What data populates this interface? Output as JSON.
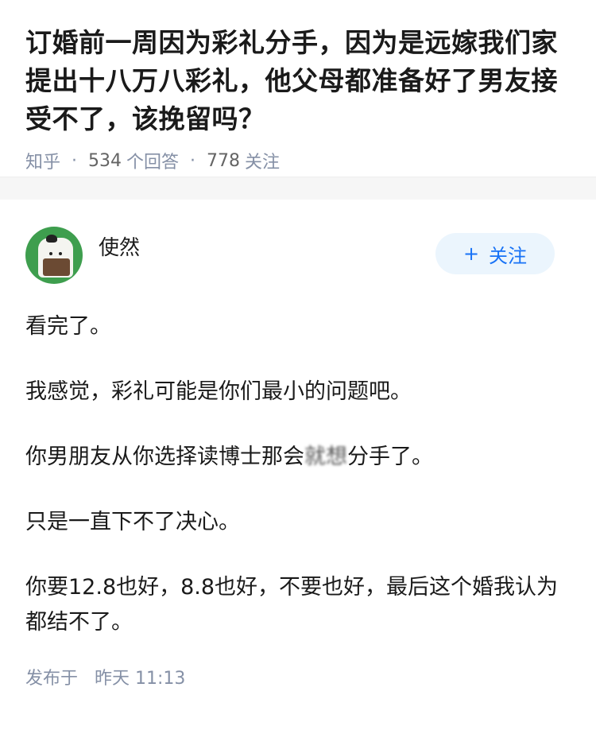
{
  "question": {
    "title": "订婚前一周因为彩礼分手，因为是远嫁我们家提出十八万八彩礼，他父母都准备好了男友接受不了，该挽留吗？",
    "source": "知乎",
    "answer_count": "534",
    "answer_label": "个回答",
    "follower_count": "778",
    "follower_label": "关注"
  },
  "answer": {
    "author_name": "使然",
    "follow_plus": "+",
    "follow_label": "关注",
    "paragraphs": {
      "p0": "看完了。",
      "p1": "我感觉，彩礼可能是你们最小的问题吧。",
      "p2_before": "你男朋友从你选择读博士那会",
      "p2_blurred": "就想",
      "p2_after": "分手了。",
      "p3": "只是一直下不了决心。",
      "p4": "你要12.8也好，8.8也好，不要也好，最后这个婚我认为都结不了。"
    },
    "publish_label": "发布于",
    "publish_time": "昨天 11:13"
  },
  "colors": {
    "accent": "#1772f6",
    "follow_bg": "#ebf5fd",
    "meta": "#8590a6",
    "avatar_bg": "#3e9e4e"
  },
  "icons": {
    "avatar": "panda-avatar-icon"
  }
}
